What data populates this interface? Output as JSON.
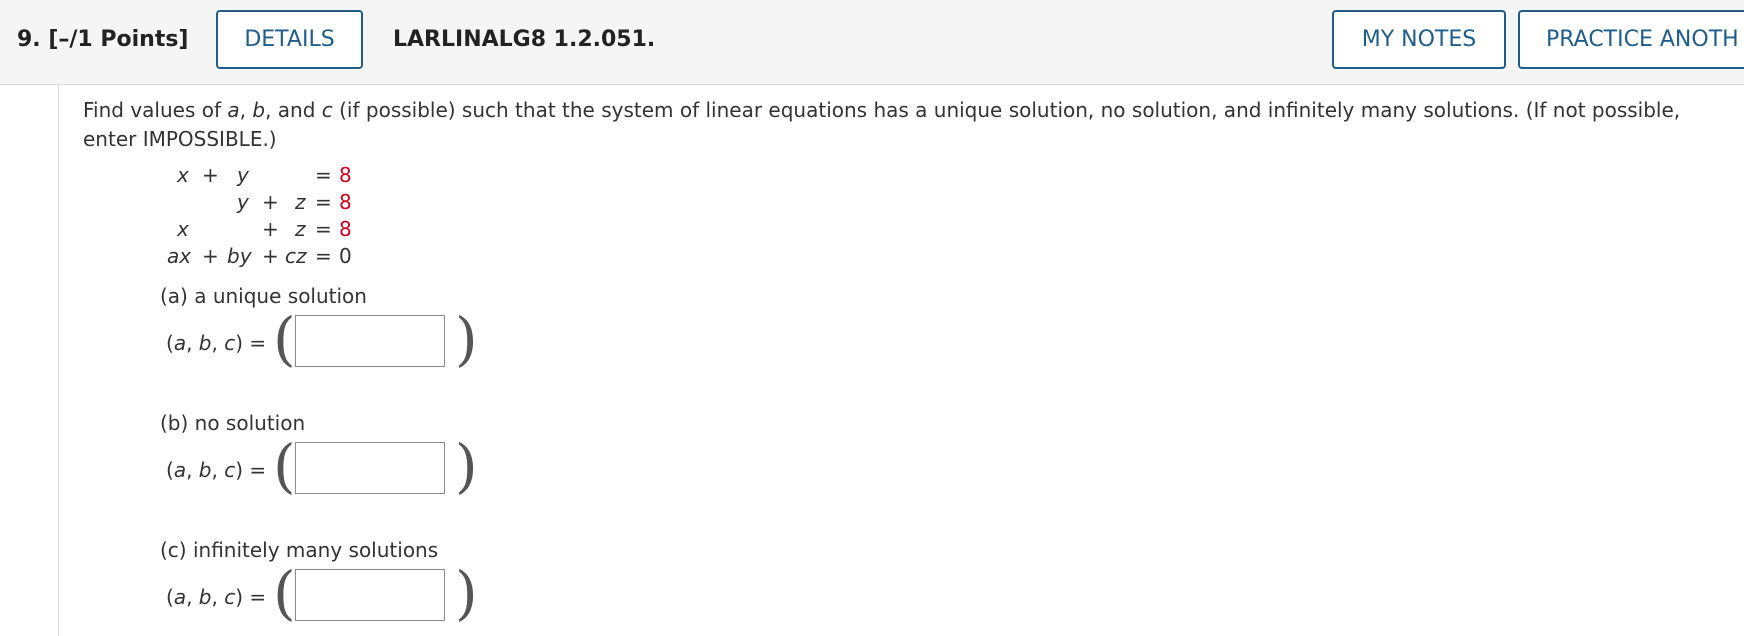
{
  "header": {
    "question_label": "9.  [–/1 Points]",
    "details_button": "DETAILS",
    "problem_code": "LARLINALG8 1.2.051.",
    "my_notes_button": "MY NOTES",
    "practice_button": "PRACTICE ANOTH"
  },
  "prompt": {
    "text_1": "Find values of ",
    "var_a": "a",
    "sep_1": ", ",
    "var_b": "b",
    "sep_2": ", and ",
    "var_c": "c",
    "text_2": " (if possible) such that the system of linear equations has a unique solution, no solution, and infinitely many solutions. (If not possible, enter IMPOSSIBLE.)"
  },
  "system": {
    "row1": {
      "x": "x",
      "plus1": "+",
      "y": "y",
      "eq": "=",
      "rhs": "8"
    },
    "row2": {
      "y": "y",
      "plus": "+",
      "z": "z",
      "eq": "=",
      "rhs": "8"
    },
    "row3": {
      "x": "x",
      "plus": "+",
      "z": "z",
      "eq": "=",
      "rhs": "8"
    },
    "row4": {
      "ax": "ax",
      "plus1": "+",
      "by": "by",
      "plus2": "+",
      "cz": "cz",
      "eq": "=",
      "rhs": "0"
    }
  },
  "parts": [
    {
      "label": "(a) a unique solution",
      "tuple_open": "(",
      "var_a": "a",
      "sep1": ", ",
      "var_b": "b",
      "sep2": ", ",
      "var_c": "c",
      "tuple_close": ") =",
      "answer_value": ""
    },
    {
      "label": "(b) no solution",
      "tuple_open": "(",
      "var_a": "a",
      "sep1": ", ",
      "var_b": "b",
      "sep2": ", ",
      "var_c": "c",
      "tuple_close": ") =",
      "answer_value": ""
    },
    {
      "label": "(c) infinitely many solutions",
      "tuple_open": "(",
      "var_a": "a",
      "sep1": ", ",
      "var_b": "b",
      "sep2": ", ",
      "var_c": "c",
      "tuple_close": ") =",
      "answer_value": ""
    }
  ],
  "paren_glyphs": {
    "open": "(",
    "close": ")"
  },
  "colors": {
    "accent": "#1f5e8c",
    "given_value": "#d0021b",
    "header_bg": "#f5f5f5"
  }
}
